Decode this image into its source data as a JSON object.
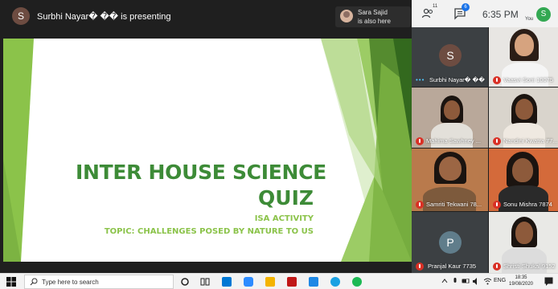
{
  "meeting": {
    "presenter_initial": "S",
    "presenting_text": "Surbhi Nayar� �� is presenting",
    "also_here_name": "Sara Sajid",
    "also_here_text": "is also here"
  },
  "toolbar": {
    "people_count": "11",
    "chat_count": "6",
    "time": "6:35 PM",
    "you_label": "You",
    "user_initial": "S",
    "icons": [
      "people-icon",
      "chat-icon"
    ]
  },
  "slide": {
    "title_line1": "INTER HOUSE SCIENCE",
    "title_line2": "QUIZ",
    "subtitle_line1": "ISA ACTIVITY",
    "subtitle_line2": "TOPIC: CHALLENGES POSED BY NATURE TO US",
    "colors": {
      "title": "#3d8b37",
      "subtitle": "#8bc34a",
      "shape_light": "#8bc34a",
      "shape_dark": "#2e7d32"
    }
  },
  "participants": [
    {
      "name": "Surbhi Nayar� ��",
      "initial": "S",
      "muted": false,
      "avatar_color": "#6d4c41"
    },
    {
      "name": "Vaasvi Soni 10075",
      "muted": true
    },
    {
      "name": "Mahima Sawhney ...",
      "muted": true
    },
    {
      "name": "Nandini Kwatra 77...",
      "muted": true
    },
    {
      "name": "Samriti Tekwani 78...",
      "muted": true
    },
    {
      "name": "Sonu Mishra 7874",
      "muted": true
    },
    {
      "name": "Pranjal Kaur 7735",
      "initial": "P",
      "muted": true,
      "avatar_color": "#607d8b"
    },
    {
      "name": "Shristi Shukal 9152",
      "muted": true
    }
  ],
  "taskbar": {
    "search_placeholder": "Type here to search",
    "language": "ENG",
    "time": "18:35",
    "date": "19/08/2020",
    "icons": [
      "windows-start-icon",
      "search-icon",
      "cortana-icon",
      "task-view-icon",
      "mail-icon",
      "zoom-icon",
      "files-icon",
      "mcafee-icon",
      "docs-icon",
      "edge-icon",
      "spotify-icon",
      "notification-icon"
    ]
  }
}
